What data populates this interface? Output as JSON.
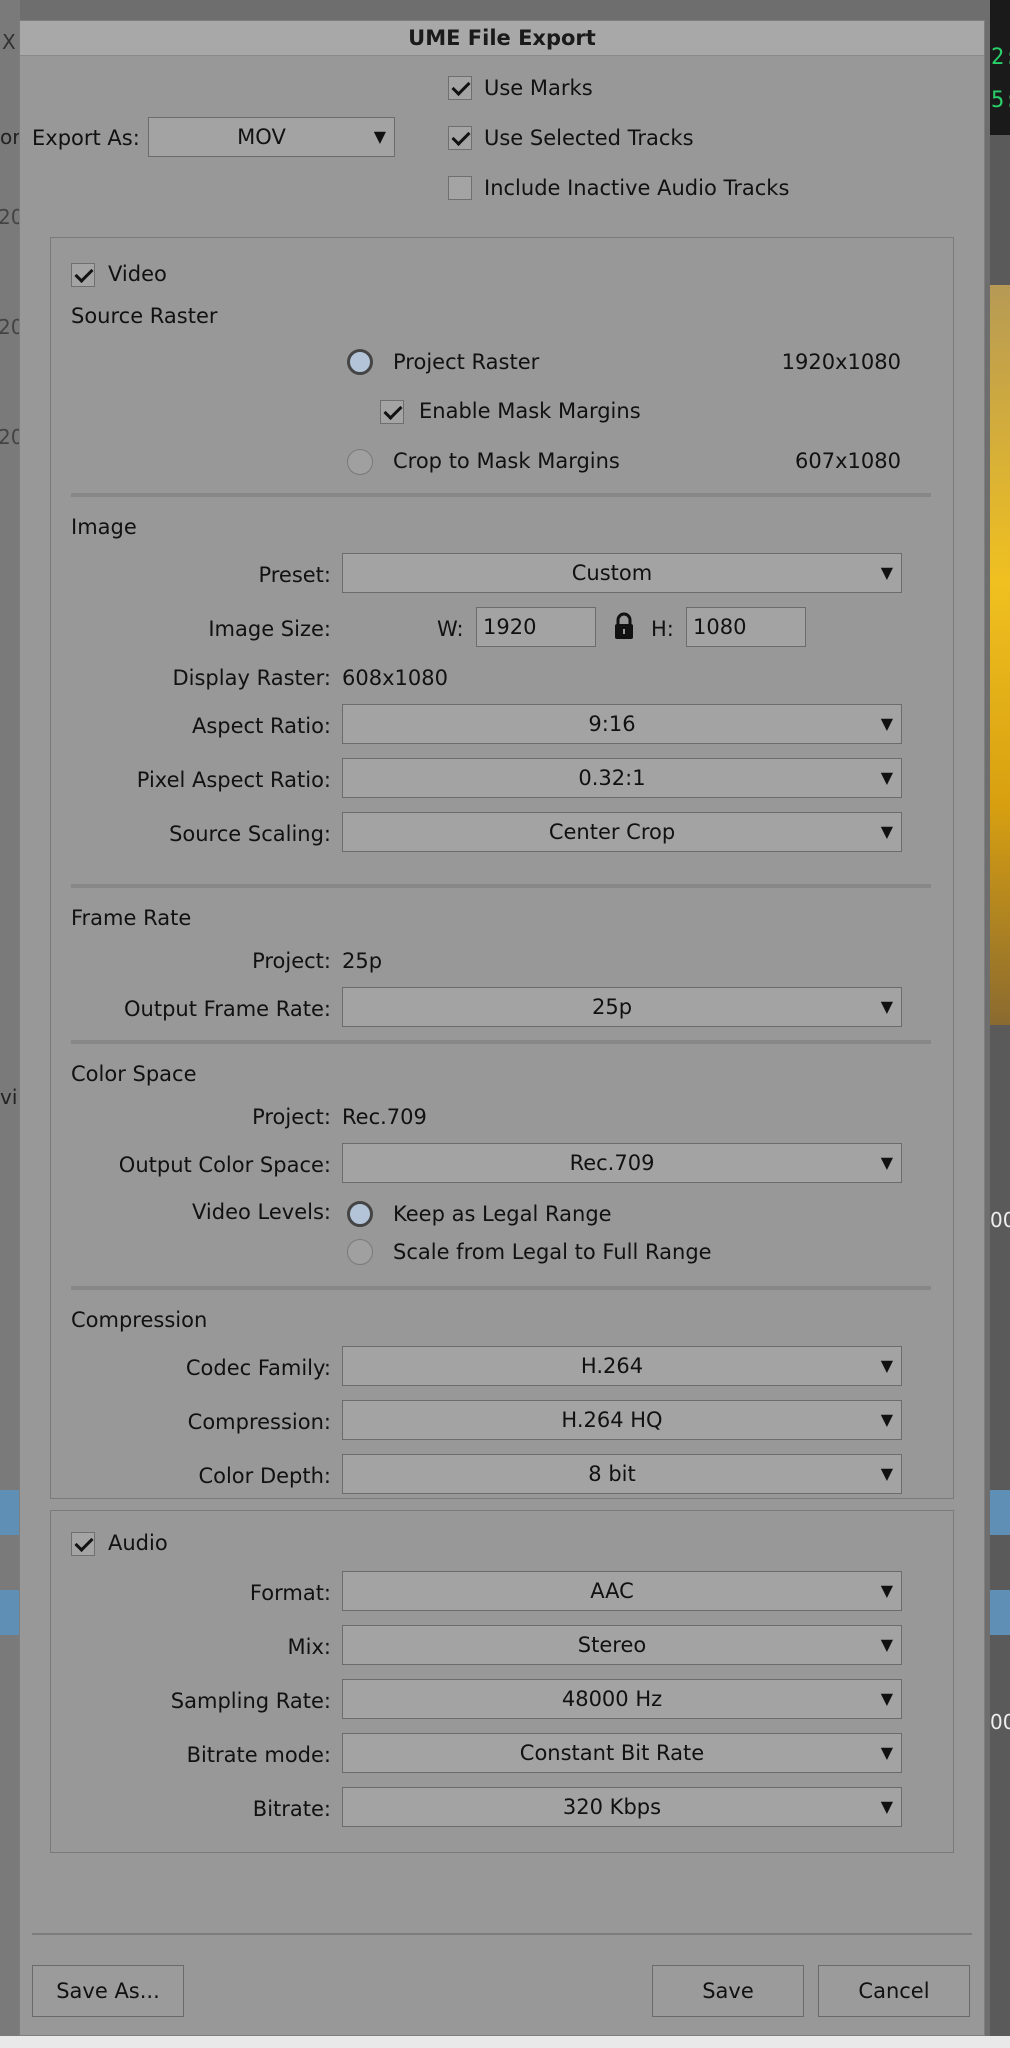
{
  "background": {
    "timecode_1": "2:",
    "timecode_2": "5:",
    "edge_1": "X",
    "edge_2": "or",
    "edge_3": "20",
    "edge_4": "20",
    "edge_5": "20",
    "edge_6": "vi",
    "edge_7": "00",
    "edge_8": "00"
  },
  "dialog": {
    "title": "UME File Export",
    "export_as_label": "Export As:",
    "export_as_value": "MOV",
    "use_marks": "Use Marks",
    "use_selected_tracks": "Use Selected Tracks",
    "include_inactive_audio": "Include Inactive Audio Tracks"
  },
  "video": {
    "label": "Video",
    "source_raster_title": "Source Raster",
    "project_raster": "Project Raster",
    "project_raster_size": "1920x1080",
    "enable_mask_margins": "Enable Mask Margins",
    "crop_to_mask": "Crop to Mask Margins",
    "crop_size": "607x1080",
    "image_title": "Image",
    "preset_label": "Preset:",
    "preset_value": "Custom",
    "image_size_label": "Image Size:",
    "w_label": "W:",
    "w_value": "1920",
    "h_label": "H:",
    "h_value": "1080",
    "display_raster_label": "Display Raster:",
    "display_raster_value": "608x1080",
    "aspect_ratio_label": "Aspect Ratio:",
    "aspect_ratio_value": "9:16",
    "pixel_aspect_label": "Pixel Aspect Ratio:",
    "pixel_aspect_value": "0.32:1",
    "source_scaling_label": "Source Scaling:",
    "source_scaling_value": "Center Crop",
    "frame_rate_title": "Frame Rate",
    "fr_project_label": "Project:",
    "fr_project_value": "25p",
    "output_fr_label": "Output Frame Rate:",
    "output_fr_value": "25p",
    "color_space_title": "Color Space",
    "cs_project_label": "Project:",
    "cs_project_value": "Rec.709",
    "output_cs_label": "Output Color Space:",
    "output_cs_value": "Rec.709",
    "video_levels_label": "Video Levels:",
    "keep_legal": "Keep as Legal Range",
    "scale_full": "Scale from Legal to Full Range",
    "compression_title": "Compression",
    "codec_family_label": "Codec Family:",
    "codec_family_value": "H.264",
    "compression_label": "Compression:",
    "compression_value": "H.264 HQ",
    "color_depth_label": "Color Depth:",
    "color_depth_value": "8 bit"
  },
  "audio": {
    "label": "Audio",
    "format_label": "Format:",
    "format_value": "AAC",
    "mix_label": "Mix:",
    "mix_value": "Stereo",
    "sampling_label": "Sampling Rate:",
    "sampling_value": "48000 Hz",
    "bitrate_mode_label": "Bitrate mode:",
    "bitrate_mode_value": "Constant Bit Rate",
    "bitrate_label": "Bitrate:",
    "bitrate_value": "320 Kbps"
  },
  "buttons": {
    "save_as": "Save As...",
    "save": "Save",
    "cancel": "Cancel"
  },
  "icons": {
    "dropdown": "▼",
    "lock": "lock-icon"
  }
}
